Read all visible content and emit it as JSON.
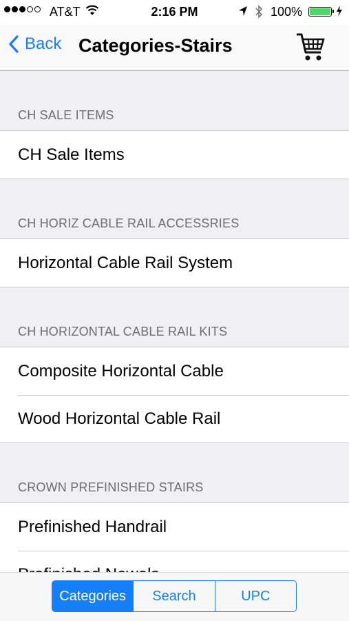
{
  "status": {
    "carrier": "AT&T",
    "time": "2:16 PM",
    "battery_text": "100%",
    "signal_icon": "signal-dots-icon",
    "wifi_icon": "wifi-icon",
    "location_icon": "location-arrow-icon",
    "bluetooth_icon": "bluetooth-icon",
    "battery_icon": "battery-icon",
    "charging_icon": "charging-bolt-icon",
    "battery_color": "#4cd964"
  },
  "nav": {
    "back_label": "Back",
    "title": "Categories-Stairs",
    "back_icon": "chevron-left-icon",
    "cart_icon": "shopping-cart-icon",
    "accent": "#157efb"
  },
  "sections": [
    {
      "header": "CH  SALE ITEMS",
      "items": [
        "CH  Sale Items"
      ]
    },
    {
      "header": "CH HORIZ CABLE RAIL ACCESSRIES",
      "items": [
        "Horizontal Cable Rail System"
      ]
    },
    {
      "header": "CH HORIZONTAL CABLE RAIL KITS",
      "items": [
        "Composite Horizontal Cable",
        "Wood Horizontal Cable Rail"
      ]
    },
    {
      "header": "CROWN PREFINISHED STAIRS",
      "items": [
        "Prefinished Handrail",
        "Prefinished Newels"
      ]
    }
  ],
  "segments": [
    {
      "label": "Categories",
      "selected": true
    },
    {
      "label": "Search",
      "selected": false
    },
    {
      "label": "UPC",
      "selected": false
    }
  ]
}
